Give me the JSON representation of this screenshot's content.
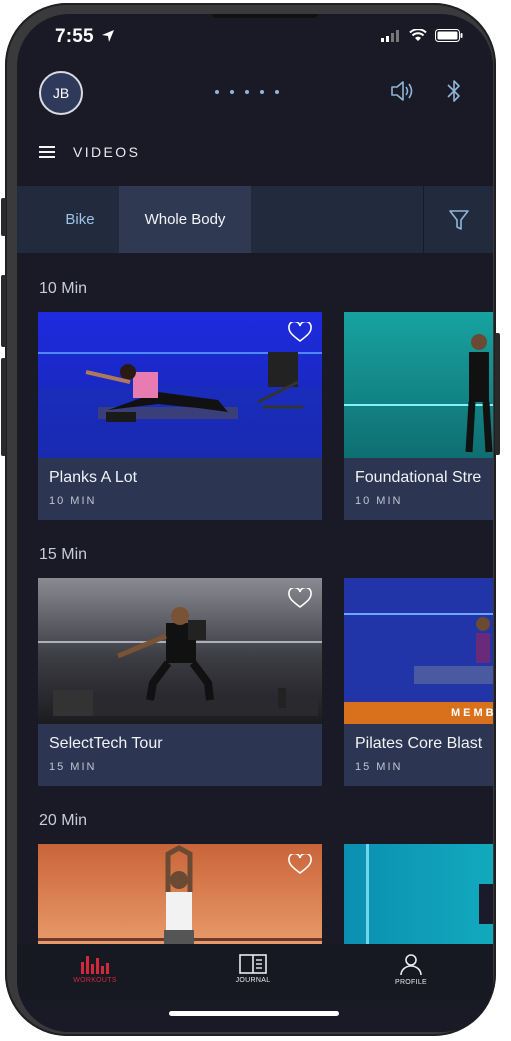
{
  "status": {
    "time": "7:55"
  },
  "header": {
    "avatar_initials": "JB",
    "page_title": "VIDEOS"
  },
  "tabs": [
    {
      "label": "Bike",
      "active": false
    },
    {
      "label": "Whole Body",
      "active": true
    }
  ],
  "sections": [
    {
      "title": "10 Min",
      "cards": [
        {
          "title": "Planks A Lot",
          "duration": "10 MIN"
        },
        {
          "title": "Foundational Stre",
          "duration": "10 MIN"
        }
      ]
    },
    {
      "title": "15 Min",
      "cards": [
        {
          "title": "SelectTech Tour",
          "duration": "15 MIN"
        },
        {
          "title": "Pilates Core Blast",
          "duration": "15 MIN",
          "badge": "MEMB"
        }
      ]
    },
    {
      "title": "20 Min"
    }
  ],
  "nav": {
    "workouts": "WORKOUTS",
    "journal": "JOURNAL",
    "profile": "PROFILE"
  },
  "colors": {
    "background": "#191a26",
    "card": "#2c3652",
    "accent_active": "#d2283c",
    "tab_text": "#9ec3e6",
    "member_badge": "#d9711c"
  },
  "icons": [
    "location-arrow-icon",
    "signal-icon",
    "wifi-icon",
    "battery-icon",
    "speaker-icon",
    "bluetooth-icon",
    "hamburger-menu-icon",
    "filter-icon",
    "heart-icon",
    "workouts-bars-icon",
    "journal-icon",
    "profile-icon"
  ]
}
